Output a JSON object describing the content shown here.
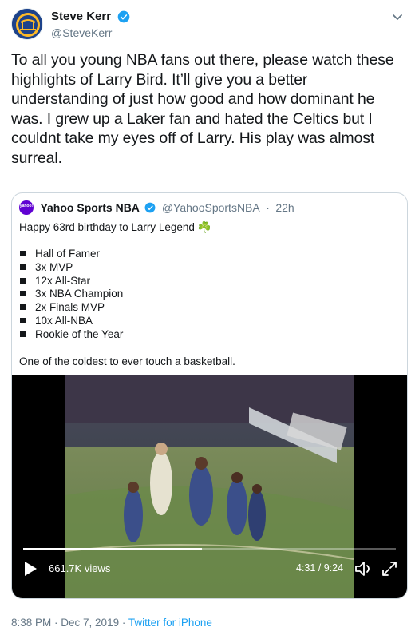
{
  "author": {
    "display_name": "Steve Kerr",
    "handle": "@SteveKerr",
    "verified": true
  },
  "tweet": {
    "text": "To all you young NBA fans out there, please watch these highlights of Larry Bird. It’ll give you a better understanding of just how good and how dominant he was. I grew up a Laker fan and hated the Celtics but I couldnt take my eyes off of Larry. His play was almost surreal."
  },
  "quoted_tweet": {
    "display_name": "Yahoo Sports NBA",
    "handle": "@YahooSportsNBA",
    "separator": "·",
    "time": "22h",
    "avatar_text": "yahoo!",
    "line1": "Happy 63rd birthday to Larry Legend ☘️",
    "list": [
      "Hall of Famer",
      "3x MVP",
      "12x All-Star",
      "3x NBA Champion",
      "2x Finals MVP",
      "10x All-NBA",
      "Rookie of the Year"
    ],
    "closing": "One of the coldest to ever touch a basketball.",
    "video": {
      "views": "661.7K views",
      "time": "4:31 / 9:24",
      "progress": 0.48
    }
  },
  "footer": {
    "time": "8:38 PM",
    "sep1": " · ",
    "date": "Dec 7, 2019",
    "sep2": " · ",
    "source": "Twitter for iPhone"
  },
  "colors": {
    "accent": "#1da1f2",
    "secondary_text": "#657786",
    "border": "#ccd6dd",
    "yahoo_purple": "#6001d2"
  }
}
